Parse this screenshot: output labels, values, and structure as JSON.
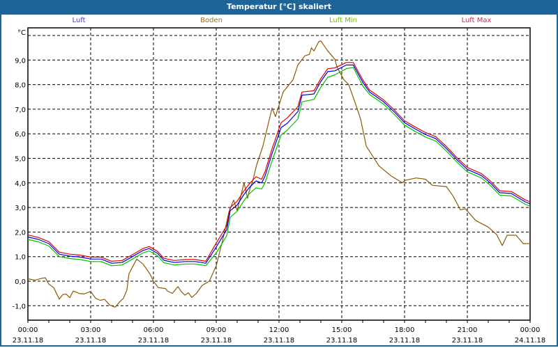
{
  "window": {
    "title": "Temperatur [°C] skaliert"
  },
  "colors": {
    "titlebar": "#1e6496",
    "luft": "#0000e0",
    "boden": "#8b5a00",
    "luft_min": "#00c000",
    "luft_max": "#e00000"
  },
  "chart_data": {
    "type": "line",
    "title": "Temperatur [°C] skaliert",
    "ylabel": "°C",
    "xlabel": "",
    "ylim": [
      -1.6,
      10.3
    ],
    "xlim": [
      0,
      24
    ],
    "grid": true,
    "legend_position": "top",
    "y_ticks": [
      -1,
      0,
      1,
      2,
      3,
      4,
      5,
      6,
      7,
      8,
      9,
      10
    ],
    "y_tick_labels": [
      "-1,0",
      "0,0",
      "1,0",
      "2,0",
      "3,0",
      "4,0",
      "5,0",
      "6,0",
      "7,0",
      "8,0",
      "9,0",
      ""
    ],
    "x_ticks": [
      0,
      3,
      6,
      9,
      12,
      15,
      18,
      21,
      24
    ],
    "x_tick_labels": [
      {
        "time": "00:00",
        "date": "23.11.18"
      },
      {
        "time": "03:00",
        "date": "23.11.18"
      },
      {
        "time": "06:00",
        "date": "23.11.18"
      },
      {
        "time": "09:00",
        "date": "23.11.18"
      },
      {
        "time": "12:00",
        "date": "23.11.18"
      },
      {
        "time": "15:00",
        "date": "23.11.18"
      },
      {
        "time": "18:00",
        "date": "23.11.18"
      },
      {
        "time": "21:00",
        "date": "23.11.18"
      },
      {
        "time": "00:00",
        "date": "24.11.18"
      }
    ],
    "air_x": [
      0,
      0.5,
      1,
      1.5,
      2,
      2.5,
      3,
      3.5,
      4,
      4.5,
      5,
      5.5,
      5.8,
      6.2,
      6.5,
      7,
      7.5,
      8,
      8.5,
      9,
      9.5,
      9.67,
      10,
      10.3,
      10.57,
      10.9,
      11.17,
      11.33,
      11.67,
      12.1,
      12.4,
      12.9,
      13.1,
      13.67,
      14,
      14.33,
      14.67,
      15.22,
      15.55,
      16,
      16.33,
      17,
      17.5,
      18,
      18.5,
      19,
      19.5,
      20,
      20.5,
      21,
      21.67,
      22.1,
      22.55,
      23.1,
      23.77,
      24
    ],
    "series": [
      {
        "name": "Luft",
        "key": "luft",
        "values": [
          1.8,
          1.7,
          1.53,
          1.1,
          1.02,
          0.98,
          0.9,
          0.9,
          0.73,
          0.76,
          1.0,
          1.25,
          1.33,
          1.13,
          0.85,
          0.76,
          0.8,
          0.8,
          0.73,
          1.39,
          2.1,
          2.87,
          3.1,
          3.5,
          3.8,
          4.08,
          4.0,
          4.27,
          5.2,
          6.25,
          6.43,
          6.9,
          7.57,
          7.62,
          8.13,
          8.53,
          8.56,
          8.8,
          8.8,
          8.1,
          7.7,
          7.3,
          6.9,
          6.45,
          6.2,
          5.97,
          5.8,
          5.4,
          4.95,
          4.55,
          4.3,
          4.0,
          3.6,
          3.57,
          3.23,
          3.15
        ]
      },
      {
        "name": "Luft Min",
        "key": "luft_min",
        "values": [
          1.7,
          1.6,
          1.43,
          1.0,
          0.92,
          0.88,
          0.8,
          0.8,
          0.63,
          0.66,
          0.9,
          1.15,
          1.23,
          1.03,
          0.75,
          0.66,
          0.7,
          0.7,
          0.63,
          1.15,
          1.85,
          2.6,
          2.85,
          3.25,
          3.55,
          3.8,
          3.75,
          4.0,
          4.9,
          5.95,
          6.15,
          6.6,
          7.3,
          7.4,
          7.9,
          8.3,
          8.4,
          8.65,
          8.7,
          7.95,
          7.6,
          7.2,
          6.8,
          6.35,
          6.1,
          5.87,
          5.7,
          5.3,
          4.85,
          4.45,
          4.2,
          3.9,
          3.5,
          3.47,
          3.13,
          3.05
        ]
      },
      {
        "name": "Luft Max",
        "key": "luft_max",
        "values": [
          1.88,
          1.78,
          1.61,
          1.18,
          1.1,
          1.06,
          0.98,
          0.98,
          0.81,
          0.84,
          1.08,
          1.33,
          1.41,
          1.21,
          0.93,
          0.84,
          0.88,
          0.88,
          0.81,
          1.55,
          2.25,
          3.0,
          3.25,
          3.65,
          3.95,
          4.25,
          4.15,
          4.45,
          5.4,
          6.45,
          6.65,
          7.1,
          7.7,
          7.75,
          8.25,
          8.65,
          8.68,
          8.9,
          8.9,
          8.2,
          7.78,
          7.38,
          6.98,
          6.53,
          6.28,
          6.05,
          5.88,
          5.48,
          5.03,
          4.63,
          4.38,
          4.08,
          3.68,
          3.65,
          3.31,
          3.23
        ]
      },
      {
        "name": "Boden",
        "key": "boden",
        "x": [
          0,
          0.33,
          0.67,
          0.83,
          1,
          1.23,
          1.5,
          1.67,
          1.83,
          2,
          2.17,
          2.45,
          2.67,
          3,
          3.23,
          3.45,
          3.67,
          3.9,
          4.17,
          4.4,
          4.57,
          4.73,
          4.83,
          5.2,
          5.5,
          5.83,
          6,
          6.23,
          6.57,
          6.67,
          6.9,
          7.17,
          7.33,
          7.5,
          7.67,
          7.83,
          8.05,
          8.33,
          8.67,
          9,
          9.17,
          9.4,
          9.6,
          9.83,
          10,
          10.33,
          10.5,
          10.57,
          10.77,
          10.93,
          11.23,
          11.33,
          11.67,
          11.83,
          12.2,
          12.67,
          12.9,
          13.23,
          13.45,
          13.55,
          13.67,
          13.9,
          14,
          14.33,
          14.67,
          14.78,
          15.1,
          15.33,
          15.55,
          15.9,
          16.17,
          16.77,
          17.33,
          17.9,
          18,
          18.55,
          19,
          19.33,
          20,
          20.33,
          20.67,
          20.9,
          21.4,
          22,
          22.4,
          22.67,
          22.9,
          23.33,
          23.67,
          24
        ],
        "values": [
          0.1,
          0.04,
          0.12,
          0.14,
          -0.12,
          -0.26,
          -0.73,
          -0.54,
          -0.53,
          -0.67,
          -0.4,
          -0.5,
          -0.52,
          -0.42,
          -0.69,
          -0.78,
          -0.74,
          -0.97,
          -1.06,
          -0.83,
          -0.69,
          -0.36,
          0.3,
          0.9,
          0.7,
          0.3,
          0,
          -0.26,
          -0.3,
          -0.4,
          -0.5,
          -0.22,
          -0.42,
          -0.57,
          -0.47,
          -0.66,
          -0.5,
          -0.17,
          0,
          0.63,
          1.2,
          2.0,
          2.8,
          3.3,
          2.87,
          4.0,
          3.37,
          3.65,
          4.17,
          4.73,
          5.5,
          5.85,
          7.05,
          6.7,
          7.7,
          8.2,
          8.8,
          9.17,
          9.23,
          9.5,
          9.37,
          9.75,
          9.78,
          9.37,
          9.03,
          8.7,
          8.2,
          8.0,
          7.48,
          6.6,
          5.5,
          4.7,
          4.3,
          4.0,
          4.1,
          4.2,
          4.15,
          3.9,
          3.85,
          3.45,
          2.9,
          2.95,
          2.47,
          2.2,
          1.9,
          1.45,
          1.87,
          1.87,
          1.53,
          1.53
        ]
      }
    ],
    "legend": [
      {
        "label": "Luft",
        "color": "#4040d0"
      },
      {
        "label": "Boden",
        "color": "#a06a10"
      },
      {
        "label": "Luft Min",
        "color": "#70c000"
      },
      {
        "label": "Luft Max",
        "color": "#c03050"
      }
    ]
  }
}
